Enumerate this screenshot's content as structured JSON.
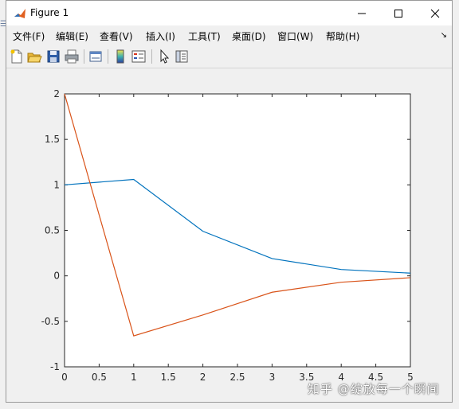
{
  "window": {
    "title": "Figure 1",
    "controls": [
      "minimize",
      "maximize",
      "close"
    ]
  },
  "menu": {
    "items": [
      "文件(F)",
      "编辑(E)",
      "查看(V)",
      "插入(I)",
      "工具(T)",
      "桌面(D)",
      "窗口(W)",
      "帮助(H)"
    ]
  },
  "toolbar": {
    "icons": [
      "new-figure-icon",
      "open-file-icon",
      "save-icon",
      "print-icon",
      "link-plot-icon",
      "colorbar-icon",
      "legend-icon",
      "pointer-icon",
      "property-editor-icon"
    ]
  },
  "watermark": "知乎 @绽放每一个瞬间",
  "chart_data": {
    "type": "line",
    "x": [
      0,
      1,
      2,
      3,
      4,
      5
    ],
    "series": [
      {
        "color": "#0072bd",
        "values": [
          1.0,
          1.06,
          0.49,
          0.19,
          0.07,
          0.03
        ]
      },
      {
        "color": "#d95319",
        "values": [
          2.0,
          -0.66,
          -0.43,
          -0.18,
          -0.07,
          -0.02
        ]
      }
    ],
    "xlim": [
      0,
      5
    ],
    "ylim": [
      -1,
      2
    ],
    "xticks": [
      0,
      0.5,
      1,
      1.5,
      2,
      2.5,
      3,
      3.5,
      4,
      4.5,
      5
    ],
    "yticks": [
      -1,
      -0.5,
      0,
      0.5,
      1,
      1.5,
      2
    ],
    "xtick_labels": [
      "0",
      "0.5",
      "1",
      "1.5",
      "2",
      "2.5",
      "3",
      "3.5",
      "4",
      "4.5",
      "5"
    ],
    "ytick_labels": [
      "-1",
      "-0.5",
      "0",
      "0.5",
      "1",
      "1.5",
      "2"
    ],
    "grid": false
  }
}
